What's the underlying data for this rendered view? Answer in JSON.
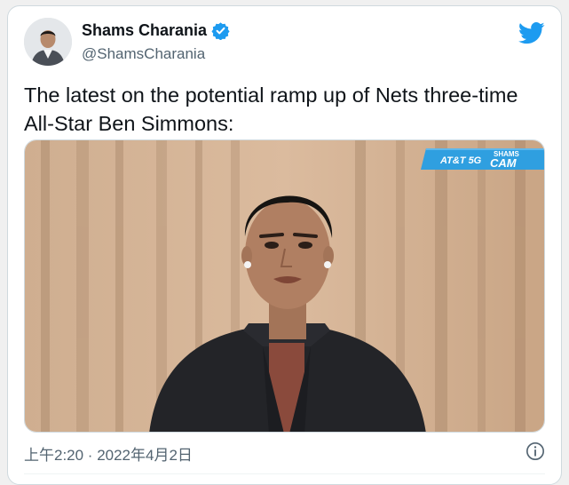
{
  "author": {
    "display_name": "Shams Charania",
    "handle": "@ShamsCharania"
  },
  "icons": {
    "verified": "verified-badge-icon",
    "platform": "twitter-bird-icon",
    "info": "info-icon"
  },
  "tweet": {
    "text": "The latest on the potential ramp up of Nets three-time All-Star Ben Simmons:"
  },
  "media": {
    "overlay_brand": "AT&T 5G",
    "overlay_show_line1": "SHAMS",
    "overlay_show_line2": "CAM"
  },
  "meta": {
    "timestamp": "上午2:20 · 2022年4月2日"
  },
  "colors": {
    "brand_blue": "#1d9bf0",
    "overlay_blue": "#2f9fe0",
    "curtain": "#d8b596"
  }
}
